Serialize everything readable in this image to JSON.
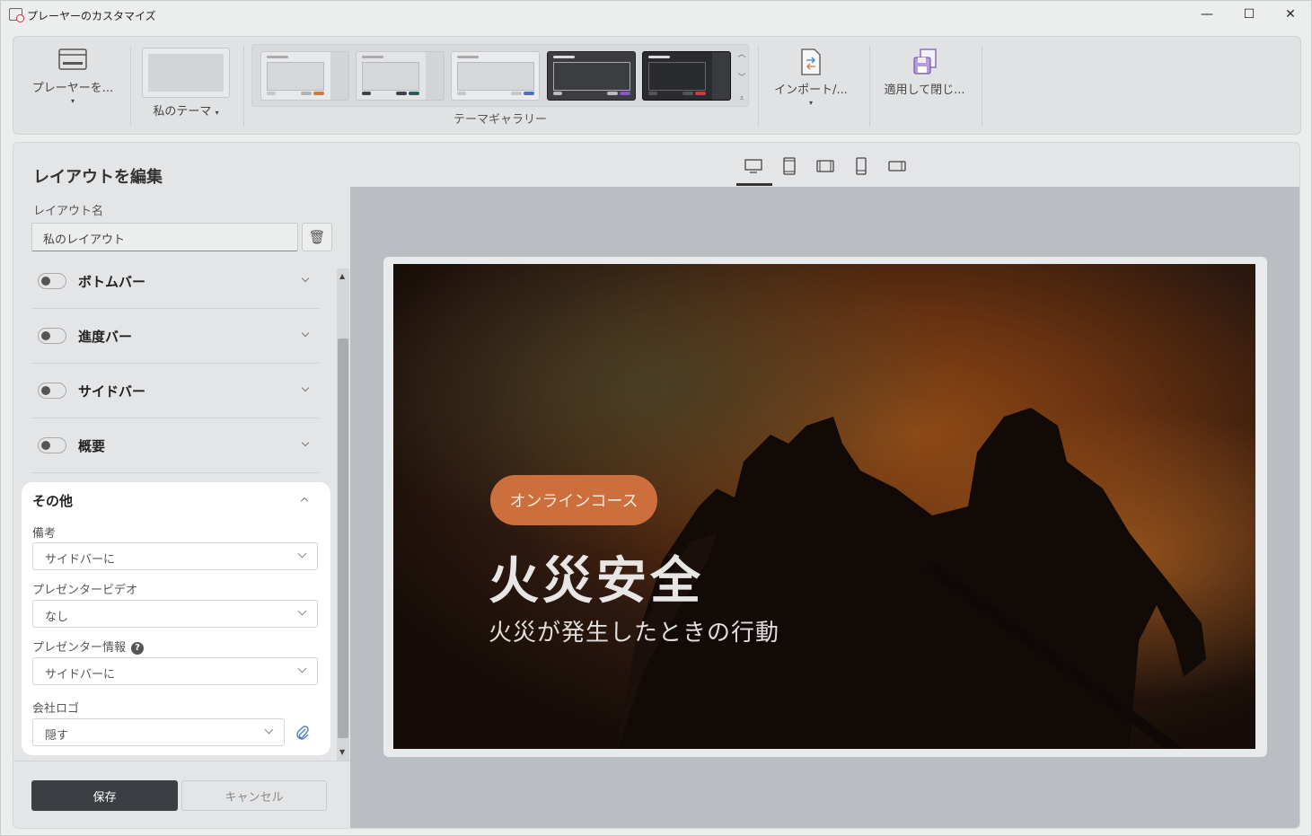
{
  "window": {
    "title": "プレーヤーのカスタマイズ",
    "minimize": "—",
    "maximize": "☐",
    "close": "✕"
  },
  "ribbon": {
    "player_btn": "プレーヤーを...",
    "my_theme": "私のテーマ",
    "theme_gallery_label": "テーマギャラリー",
    "import_btn": "インポート/...",
    "apply_close_btn": "適用して閉じ..."
  },
  "left_panel": {
    "title": "レイアウトを編集",
    "layout_name_label": "レイアウト名",
    "layout_name_value": "私のレイアウト",
    "sections": [
      {
        "label": "ボトムバー",
        "enabled": false
      },
      {
        "label": "進度バー",
        "enabled": false
      },
      {
        "label": "サイドバー",
        "enabled": false
      },
      {
        "label": "概要",
        "enabled": false
      }
    ],
    "other": {
      "title": "その他",
      "notes_label": "備考",
      "notes_value": "サイドバーに",
      "presenter_video_label": "プレゼンタービデオ",
      "presenter_video_value": "なし",
      "presenter_info_label": "プレゼンター情報",
      "presenter_info_value": "サイドバーに",
      "company_logo_label": "会社ロゴ",
      "company_logo_value": "隠す"
    },
    "save_btn": "保存",
    "cancel_btn": "キャンセル"
  },
  "preview": {
    "badge": "オンラインコース",
    "title": "火災安全",
    "subtitle": "火災が発生したときの行動"
  },
  "colors": {
    "badge": "#cd6f3c",
    "save_button": "#3b3e43",
    "attach_icon": "#4a7fc1"
  }
}
